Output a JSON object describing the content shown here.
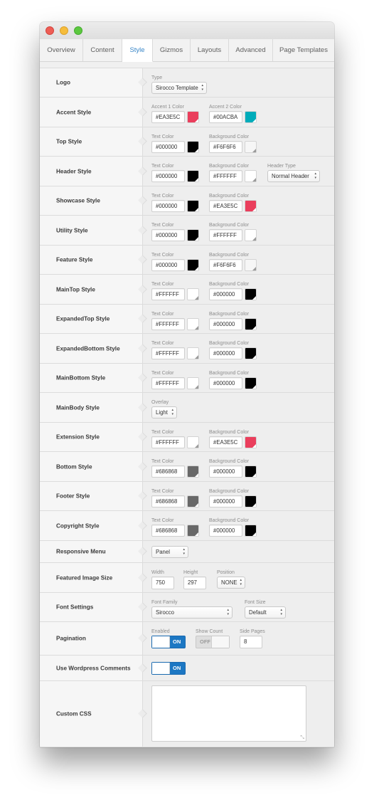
{
  "tabs": [
    "Overview",
    "Content",
    "Style",
    "Gizmos",
    "Layouts",
    "Advanced",
    "Page Templates"
  ],
  "active_tab": "Style",
  "rows": [
    {
      "label": "Logo",
      "fields": [
        {
          "type": "select",
          "label": "Type",
          "value": "Sirocco Template"
        }
      ]
    },
    {
      "label": "Accent Style",
      "fields": [
        {
          "type": "color",
          "label": "Accent 1 Color",
          "value": "#EA3E5C",
          "swatch": "#EA3E5C"
        },
        {
          "type": "color",
          "label": "Accent 2 Color",
          "value": "#00ACBA",
          "swatch": "#00ACBA"
        }
      ]
    },
    {
      "label": "Top Style",
      "fields": [
        {
          "type": "color",
          "label": "Text Color",
          "value": "#000000",
          "swatch": "#000000"
        },
        {
          "type": "color",
          "label": "Background Color",
          "value": "#F6F6F6",
          "swatch": "#F6F6F6"
        }
      ]
    },
    {
      "label": "Header Style",
      "fields": [
        {
          "type": "color",
          "label": "Text Color",
          "value": "#000000",
          "swatch": "#000000"
        },
        {
          "type": "color",
          "label": "Background Color",
          "value": "#FFFFFF",
          "swatch": "#FFFFFF"
        },
        {
          "type": "select",
          "label": "Header Type",
          "value": "Normal Header"
        }
      ]
    },
    {
      "label": "Showcase Style",
      "fields": [
        {
          "type": "color",
          "label": "Text Color",
          "value": "#000000",
          "swatch": "#000000"
        },
        {
          "type": "color",
          "label": "Background Color",
          "value": "#EA3E5C",
          "swatch": "#EA3E5C"
        }
      ]
    },
    {
      "label": "Utility Style",
      "fields": [
        {
          "type": "color",
          "label": "Text Color",
          "value": "#000000",
          "swatch": "#000000"
        },
        {
          "type": "color",
          "label": "Background Color",
          "value": "#FFFFFF",
          "swatch": "#FFFFFF"
        }
      ]
    },
    {
      "label": "Feature Style",
      "fields": [
        {
          "type": "color",
          "label": "Text Color",
          "value": "#000000",
          "swatch": "#000000"
        },
        {
          "type": "color",
          "label": "Background Color",
          "value": "#F6F6F6",
          "swatch": "#F6F6F6"
        }
      ]
    },
    {
      "label": "MainTop Style",
      "fields": [
        {
          "type": "color",
          "label": "Text Color",
          "value": "#FFFFFF",
          "swatch": "#FFFFFF"
        },
        {
          "type": "color",
          "label": "Background Color",
          "value": "#000000",
          "swatch": "#000000"
        }
      ]
    },
    {
      "label": "ExpandedTop Style",
      "fields": [
        {
          "type": "color",
          "label": "Text Color",
          "value": "#FFFFFF",
          "swatch": "#FFFFFF"
        },
        {
          "type": "color",
          "label": "Background Color",
          "value": "#000000",
          "swatch": "#000000"
        }
      ]
    },
    {
      "label": "ExpandedBottom Style",
      "fields": [
        {
          "type": "color",
          "label": "Text Color",
          "value": "#FFFFFF",
          "swatch": "#FFFFFF"
        },
        {
          "type": "color",
          "label": "Background Color",
          "value": "#000000",
          "swatch": "#000000"
        }
      ]
    },
    {
      "label": "MainBottom Style",
      "fields": [
        {
          "type": "color",
          "label": "Text Color",
          "value": "#FFFFFF",
          "swatch": "#FFFFFF"
        },
        {
          "type": "color",
          "label": "Background Color",
          "value": "#000000",
          "swatch": "#000000"
        }
      ]
    },
    {
      "label": "MainBody Style",
      "fields": [
        {
          "type": "select",
          "label": "Overlay",
          "value": "Light"
        }
      ]
    },
    {
      "label": "Extension Style",
      "fields": [
        {
          "type": "color",
          "label": "Text Color",
          "value": "#FFFFFF",
          "swatch": "#FFFFFF"
        },
        {
          "type": "color",
          "label": "Background Color",
          "value": "#EA3E5C",
          "swatch": "#EA3E5C"
        }
      ]
    },
    {
      "label": "Bottom Style",
      "fields": [
        {
          "type": "color",
          "label": "Text Color",
          "value": "#686868",
          "swatch": "#686868"
        },
        {
          "type": "color",
          "label": "Background Color",
          "value": "#000000",
          "swatch": "#000000"
        }
      ]
    },
    {
      "label": "Footer Style",
      "fields": [
        {
          "type": "color",
          "label": "Text Color",
          "value": "#686868",
          "swatch": "#686868"
        },
        {
          "type": "color",
          "label": "Background Color",
          "value": "#000000",
          "swatch": "#000000"
        }
      ]
    },
    {
      "label": "Copyright Style",
      "fields": [
        {
          "type": "color",
          "label": "Text Color",
          "value": "#686868",
          "swatch": "#686868"
        },
        {
          "type": "color",
          "label": "Background Color",
          "value": "#000000",
          "swatch": "#000000"
        }
      ]
    },
    {
      "label": "Responsive Menu",
      "fields": [
        {
          "type": "select",
          "label": "",
          "value": "Panel"
        }
      ]
    },
    {
      "label": "Featured Image Size",
      "fields": [
        {
          "type": "text",
          "label": "Width",
          "value": "750"
        },
        {
          "type": "text",
          "label": "Height",
          "value": "297"
        },
        {
          "type": "select",
          "label": "Position",
          "value": "NONE"
        }
      ]
    },
    {
      "label": "Font Settings",
      "fields": [
        {
          "type": "select",
          "label": "Font Family",
          "value": "Sirocco"
        },
        {
          "type": "select",
          "label": "Font Size",
          "value": "Default"
        }
      ]
    },
    {
      "label": "Pagination",
      "fields": [
        {
          "type": "toggle",
          "label": "Enabled",
          "value": "ON",
          "state": true
        },
        {
          "type": "toggle",
          "label": "Show Count",
          "value": "OFF",
          "state": false
        },
        {
          "type": "text",
          "label": "Side Pages",
          "value": "8"
        }
      ]
    },
    {
      "label": "Use Wordpress Comments",
      "fields": [
        {
          "type": "toggle",
          "label": "",
          "value": "ON",
          "state": true
        }
      ]
    },
    {
      "label": "Custom CSS",
      "fields": [
        {
          "type": "textarea",
          "label": "",
          "value": ""
        }
      ]
    }
  ]
}
